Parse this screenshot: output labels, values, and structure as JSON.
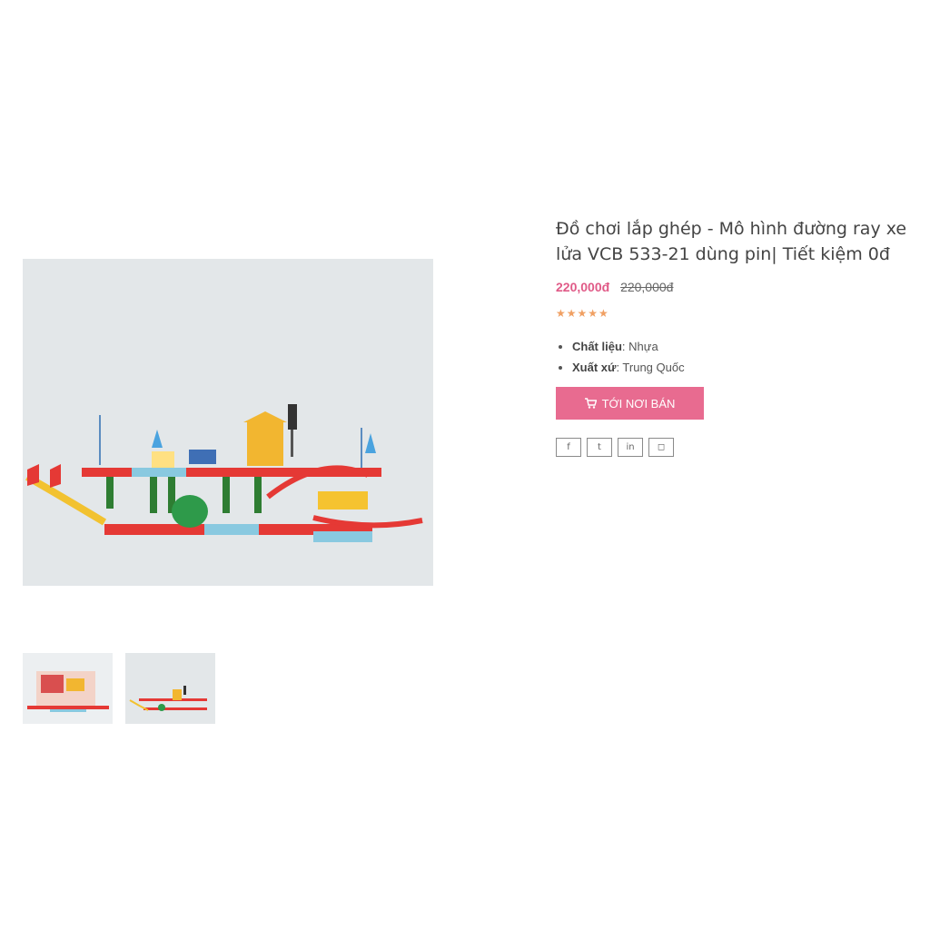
{
  "product": {
    "title": "Đồ chơi lắp ghép - Mô hình đường ray xe lửa VCB 533-21 dùng pin| Tiết kiệm 0đ",
    "price": "220,000đ",
    "old_price": "220,000đ",
    "rating_stars": "★★★★★",
    "attributes": [
      {
        "label": "Chất liệu",
        "value": ": Nhựa"
      },
      {
        "label": "Xuất xứ",
        "value": ": Trung Quốc"
      }
    ],
    "buy_button_label": "TỚI NƠI BÁN",
    "buy_button_icon": "cart-icon"
  },
  "socials": [
    {
      "icon": "facebook-icon",
      "glyph": "f"
    },
    {
      "icon": "twitter-icon",
      "glyph": "t"
    },
    {
      "icon": "linkedin-icon",
      "glyph": "in"
    },
    {
      "icon": "instagram-icon",
      "glyph": "◻"
    }
  ],
  "colors": {
    "accent": "#e86b90",
    "price": "#e05a87",
    "stars": "#f0a063"
  }
}
